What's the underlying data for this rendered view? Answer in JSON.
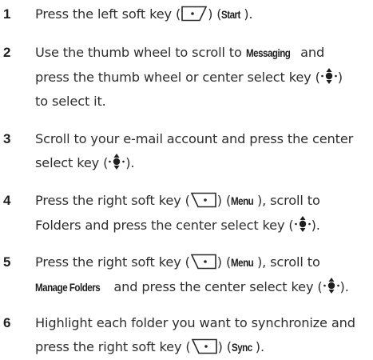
{
  "steps": [
    {
      "num": "1",
      "t1": "Press the left soft key (",
      "t2": ") (",
      "key": "Start",
      "t3": ")."
    },
    {
      "num": "2",
      "a1": "Use the thumb wheel to scroll to ",
      "key": "Messaging",
      "a2": " and",
      "b1": "press the thumb wheel or center select key (",
      "b2": ")",
      "c1": "to select it."
    },
    {
      "num": "3",
      "a1": "Scroll to your e-mail account and press the center",
      "b1": "select key (",
      "b2": ")."
    },
    {
      "num": "4",
      "a1": "Press the right soft key (",
      "a2": ") (",
      "key": "Menu",
      "a3": "), scroll to",
      "b1": "Folders and press the center select key (",
      "b2": ")."
    },
    {
      "num": "5",
      "a1": "Press the right soft key (",
      "a2": ") (",
      "key": "Menu",
      "a3": "), scroll to",
      "key2": "Manage Folders",
      "b1": " and press the center select key (",
      "b2": ")."
    },
    {
      "num": "6",
      "a1": "Highlight each folder you want to synchronize and",
      "b1": "press the right soft key (",
      "b2": ") (",
      "key": "Sync",
      "b3": ")."
    }
  ],
  "icons": {
    "left_soft_key": "left-soft-key-icon",
    "right_soft_key": "right-soft-key-icon",
    "center_select_key": "center-select-key-icon"
  }
}
